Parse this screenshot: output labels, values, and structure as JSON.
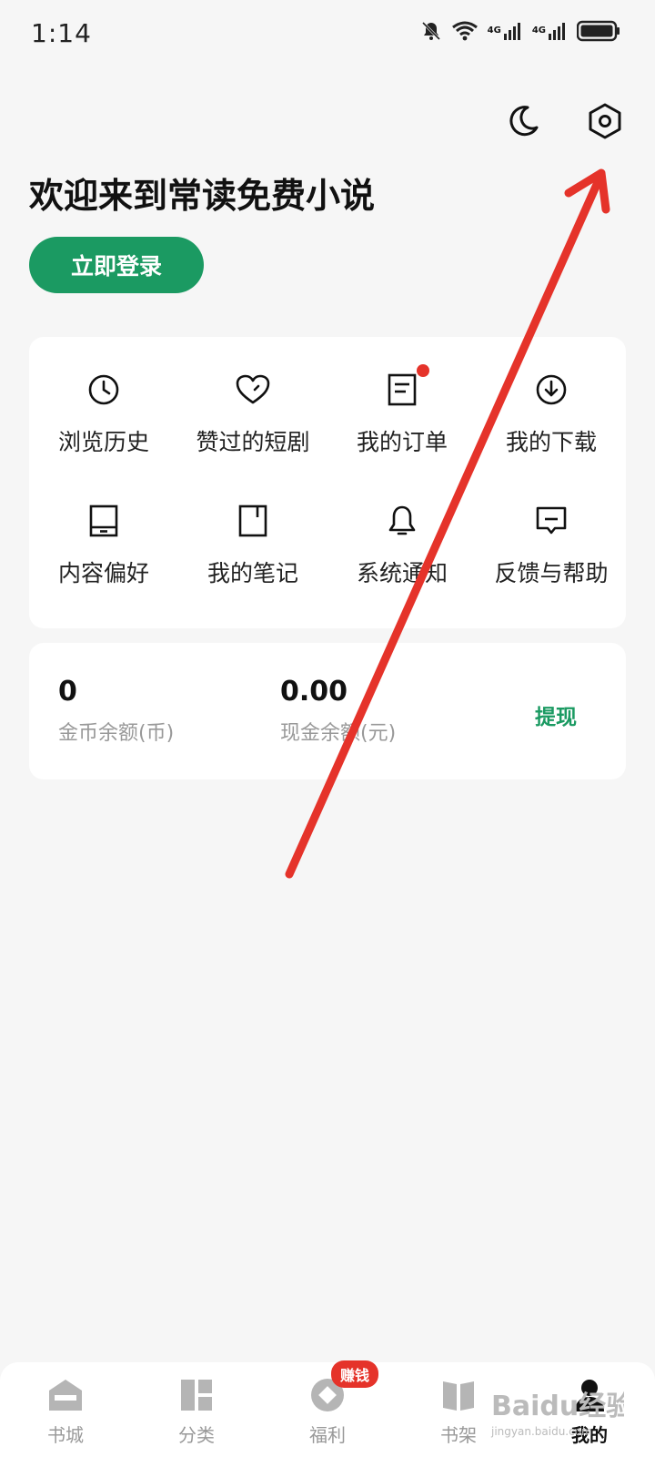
{
  "status_bar": {
    "time": "1:14",
    "network_1": "4G",
    "network_2": "4G",
    "icons": [
      "mute-bell-icon",
      "wifi-icon",
      "signal-icon",
      "signal-icon",
      "battery-icon"
    ]
  },
  "header": {
    "title": "欢迎来到常读免费小说",
    "login_label": "立即登录",
    "actions": [
      "night-mode-icon",
      "settings-icon"
    ]
  },
  "menu": {
    "items": [
      {
        "label": "浏览历史",
        "icon": "clock-icon"
      },
      {
        "label": "赞过的短剧",
        "icon": "heart-icon"
      },
      {
        "label": "我的订单",
        "icon": "order-icon",
        "has_dot": true
      },
      {
        "label": "我的下载",
        "icon": "download-icon"
      },
      {
        "label": "内容偏好",
        "icon": "tablet-icon"
      },
      {
        "label": "我的笔记",
        "icon": "note-icon"
      },
      {
        "label": "系统通知",
        "icon": "bell-icon"
      },
      {
        "label": "反馈与帮助",
        "icon": "feedback-icon"
      }
    ]
  },
  "wallet": {
    "coins_value": "0",
    "coins_label": "金币余额(币)",
    "cash_value": "0.00",
    "cash_label": "现金余额(元)",
    "withdraw_label": "提现"
  },
  "bottom_nav": {
    "items": [
      {
        "label": "书城",
        "icon": "home-icon"
      },
      {
        "label": "分类",
        "icon": "category-icon"
      },
      {
        "label": "福利",
        "icon": "coin-icon",
        "badge": "赚钱"
      },
      {
        "label": "书架",
        "icon": "bookshelf-icon"
      },
      {
        "label": "我的",
        "icon": "profile-icon",
        "active": true
      }
    ]
  },
  "watermark": {
    "text": "Baidu经验",
    "sub": "jingyan.baidu.com"
  },
  "colors": {
    "accent": "#1b9a62",
    "badge": "#e5332a",
    "annotation_arrow": "#e5332a"
  }
}
